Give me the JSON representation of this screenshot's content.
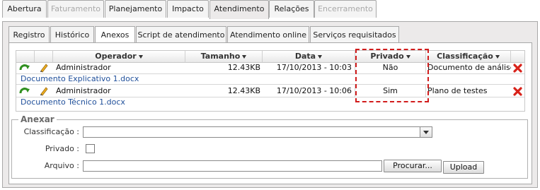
{
  "main_tabs": [
    {
      "label": "Abertura",
      "state": "normal"
    },
    {
      "label": "Faturamento",
      "state": "disabled"
    },
    {
      "label": "Planejamento",
      "state": "normal"
    },
    {
      "label": "Impacto",
      "state": "normal"
    },
    {
      "label": "Atendimento",
      "state": "active"
    },
    {
      "label": "Relações",
      "state": "normal"
    },
    {
      "label": "Encerramento",
      "state": "disabled"
    }
  ],
  "sub_tabs": [
    {
      "label": "Registro"
    },
    {
      "label": "Histórico"
    },
    {
      "label": "Anexos",
      "active": true
    },
    {
      "label": "Script de atendimento"
    },
    {
      "label": "Atendimento online"
    },
    {
      "label": "Serviços requisitados"
    }
  ],
  "grid": {
    "headers": {
      "operador": "Operador",
      "tamanho": "Tamanho",
      "data": "Data",
      "privado": "Privado",
      "classificacao": "Classificação"
    },
    "rows": [
      {
        "operador": "Administrador",
        "tamanho": "12.43KB",
        "data": "17/10/2013 - 10:03",
        "privado": "Não",
        "classificacao": "Documento de análise",
        "documento": "Documento Explicativo 1.docx"
      },
      {
        "operador": "Administrador",
        "tamanho": "12.43KB",
        "data": "17/10/2013 - 10:06",
        "privado": "Sim",
        "classificacao": "Plano de testes",
        "documento": "Documento Técnico 1.docx"
      }
    ],
    "row_icons": [
      "refresh-icon",
      "edit-pencil-icon",
      "delete-x-icon"
    ],
    "highlight_color": "#d11c1c"
  },
  "anexar": {
    "legend": "Anexar",
    "classificacao_label": "Classificação :",
    "classificacao_value": "",
    "privado_label": "Privado :",
    "privado_checked": false,
    "arquivo_label": "Arquivo :",
    "arquivo_value": "",
    "procurar_button": "Procurar...",
    "upload_button": "Upload"
  }
}
